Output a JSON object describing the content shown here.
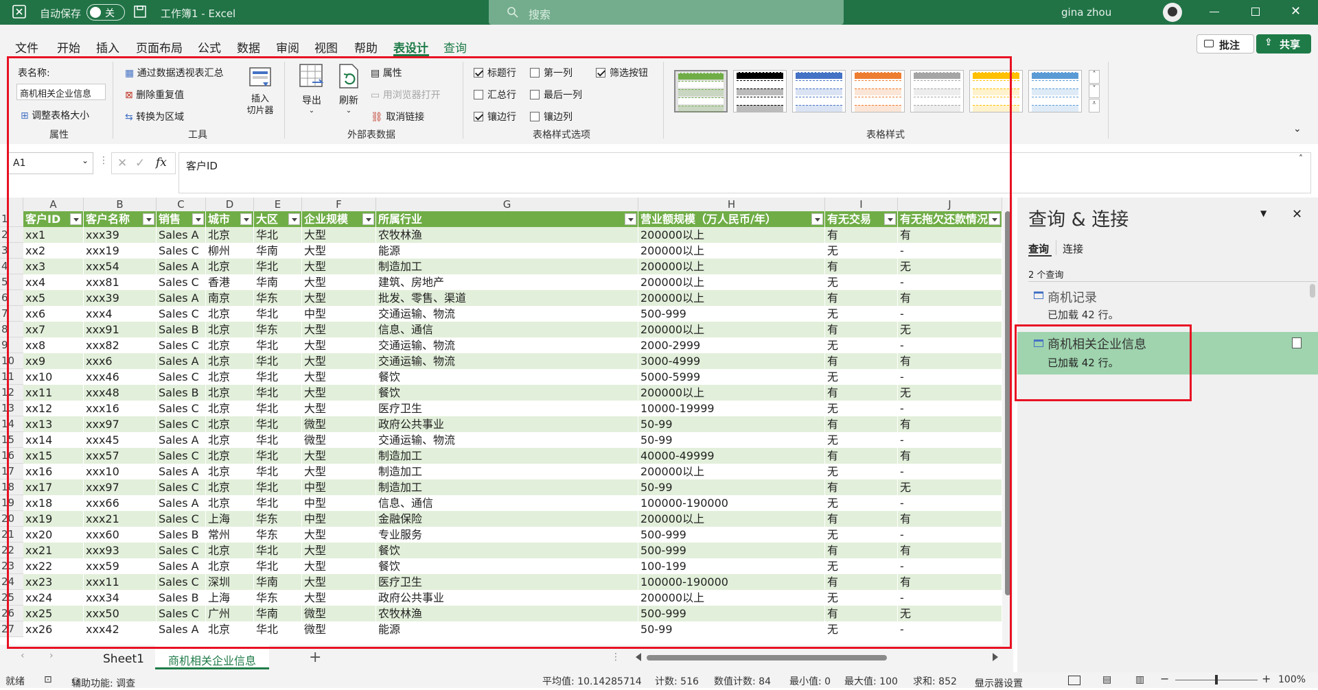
{
  "titlebar": {
    "autosave_label": "自动保存",
    "autosave_state": "关",
    "file_title": "工作簿1 - Excel",
    "search_placeholder": "搜索",
    "user_name": "gina zhou"
  },
  "menu": {
    "tabs": [
      "文件",
      "开始",
      "插入",
      "页面布局",
      "公式",
      "数据",
      "审阅",
      "视图",
      "帮助",
      "表设计",
      "查询"
    ],
    "comment_label": "批注",
    "share_label": "共享"
  },
  "ribbon": {
    "table_name_label": "表名称:",
    "table_name_value": "商机相关企业信息",
    "resize_label": "调整表格大小",
    "group_properties": "属性",
    "pivot_label": "通过数据透视表汇总",
    "remove_dup_label": "删除重复值",
    "convert_range_label": "转换为区域",
    "slicer_label": "插入\n切片器",
    "group_tools": "工具",
    "export_label": "导出",
    "refresh_label": "刷新",
    "props_label": "属性",
    "browser_label": "用浏览器打开",
    "unlink_label": "取消链接",
    "group_external": "外部表数据",
    "opt_header": "标题行",
    "opt_total": "汇总行",
    "opt_banded_rows": "镶边行",
    "opt_first_col": "第一列",
    "opt_last_col": "最后一列",
    "opt_banded_cols": "镶边列",
    "opt_filter": "筛选按钮",
    "group_options": "表格样式选项",
    "group_styles": "表格样式",
    "style_colors": [
      "#70ad47",
      "#000000",
      "#4472c4",
      "#ed7d31",
      "#a5a5a5",
      "#ffc000",
      "#5b9bd5"
    ]
  },
  "formula": {
    "cell_ref": "A1",
    "content": "客户ID"
  },
  "sheet": {
    "columns": [
      "A",
      "B",
      "C",
      "D",
      "E",
      "F",
      "G",
      "H",
      "I",
      "J"
    ],
    "headers": [
      "客户ID",
      "客户名称",
      "销售",
      "城市",
      "大区",
      "企业规模",
      "所属行业",
      "营业额规模（万人民币/年）",
      "有无交易",
      "有无拖欠还款情况"
    ],
    "rows": [
      [
        "xx1",
        "xxx39",
        "Sales A",
        "北京",
        "华北",
        "大型",
        "农牧林渔",
        "200000以上",
        "有",
        "有"
      ],
      [
        "xx2",
        "xxx19",
        "Sales C",
        "柳州",
        "华南",
        "大型",
        "能源",
        "200000以上",
        "无",
        "-"
      ],
      [
        "xx3",
        "xxx54",
        "Sales A",
        "北京",
        "华北",
        "大型",
        "制造加工",
        "200000以上",
        "有",
        "无"
      ],
      [
        "xx4",
        "xxx81",
        "Sales C",
        "香港",
        "华南",
        "大型",
        "建筑、房地产",
        "200000以上",
        "无",
        "-"
      ],
      [
        "xx5",
        "xxx39",
        "Sales A",
        "南京",
        "华东",
        "大型",
        "批发、零售、渠道",
        "200000以上",
        "有",
        "有"
      ],
      [
        "xx6",
        "xxx4",
        "Sales C",
        "北京",
        "华北",
        "中型",
        "交通运输、物流",
        "500-999",
        "无",
        "-"
      ],
      [
        "xx7",
        "xxx91",
        "Sales B",
        "北京",
        "华东",
        "大型",
        "信息、通信",
        "200000以上",
        "有",
        "无"
      ],
      [
        "xx8",
        "xxx82",
        "Sales C",
        "北京",
        "华北",
        "大型",
        "交通运输、物流",
        "2000-2999",
        "无",
        "-"
      ],
      [
        "xx9",
        "xxx6",
        "Sales A",
        "北京",
        "华北",
        "大型",
        "交通运输、物流",
        "3000-4999",
        "有",
        "有"
      ],
      [
        "xx10",
        "xxx46",
        "Sales C",
        "北京",
        "华北",
        "大型",
        "餐饮",
        "5000-5999",
        "无",
        "-"
      ],
      [
        "xx11",
        "xxx48",
        "Sales B",
        "北京",
        "华北",
        "大型",
        "餐饮",
        "200000以上",
        "有",
        "无"
      ],
      [
        "xx12",
        "xxx16",
        "Sales C",
        "北京",
        "华北",
        "大型",
        "医疗卫生",
        "10000-19999",
        "无",
        "-"
      ],
      [
        "xx13",
        "xxx97",
        "Sales C",
        "北京",
        "华北",
        "微型",
        "政府公共事业",
        "50-99",
        "有",
        "有"
      ],
      [
        "xx14",
        "xxx45",
        "Sales A",
        "北京",
        "华北",
        "微型",
        "交通运输、物流",
        "50-99",
        "无",
        "-"
      ],
      [
        "xx15",
        "xxx57",
        "Sales C",
        "北京",
        "华北",
        "大型",
        "制造加工",
        "40000-49999",
        "有",
        "有"
      ],
      [
        "xx16",
        "xxx10",
        "Sales A",
        "北京",
        "华北",
        "大型",
        "制造加工",
        "200000以上",
        "无",
        "-"
      ],
      [
        "xx17",
        "xxx97",
        "Sales C",
        "北京",
        "华北",
        "中型",
        "制造加工",
        "50-99",
        "有",
        "无"
      ],
      [
        "xx18",
        "xxx66",
        "Sales A",
        "北京",
        "华北",
        "中型",
        "信息、通信",
        "100000-190000",
        "无",
        "-"
      ],
      [
        "xx19",
        "xxx21",
        "Sales C",
        "上海",
        "华东",
        "中型",
        "金融保险",
        "200000以上",
        "有",
        "有"
      ],
      [
        "xx20",
        "xxx60",
        "Sales B",
        "常州",
        "华东",
        "大型",
        "专业服务",
        "500-999",
        "无",
        "-"
      ],
      [
        "xx21",
        "xxx93",
        "Sales C",
        "北京",
        "华北",
        "大型",
        "餐饮",
        "500-999",
        "有",
        "有"
      ],
      [
        "xx22",
        "xxx59",
        "Sales A",
        "北京",
        "华北",
        "大型",
        "餐饮",
        "100-199",
        "无",
        "-"
      ],
      [
        "xx23",
        "xxx11",
        "Sales C",
        "深圳",
        "华南",
        "大型",
        "医疗卫生",
        "100000-190000",
        "有",
        "有"
      ],
      [
        "xx24",
        "xxx34",
        "Sales B",
        "上海",
        "华东",
        "大型",
        "政府公共事业",
        "200000以上",
        "无",
        "-"
      ],
      [
        "xx25",
        "xxx50",
        "Sales C",
        "广州",
        "华南",
        "微型",
        "农牧林渔",
        "500-999",
        "有",
        "无"
      ],
      [
        "xx26",
        "xxx42",
        "Sales A",
        "北京",
        "华北",
        "微型",
        "能源",
        "50-99",
        "无",
        "-"
      ]
    ],
    "tabs": [
      "Sheet1",
      "商机相关企业信息"
    ]
  },
  "pane": {
    "title": "查询 & 连接",
    "tab_queries": "查询",
    "tab_connections": "连接",
    "count_label": "2 个查询",
    "queries": [
      {
        "name": "商机记录",
        "status": "已加载 42 行。"
      },
      {
        "name": "商机相关企业信息",
        "status": "已加载 42 行。"
      }
    ]
  },
  "status": {
    "ready": "就绪",
    "accessibility": "辅助功能: 调查",
    "average": "平均值: 10.14285714",
    "count": "计数: 516",
    "numcount": "数值计数: 84",
    "min": "最小值: 0",
    "max": "最大值: 100",
    "sum": "求和: 852",
    "display_settings": "显示器设置",
    "zoom": "100%"
  }
}
